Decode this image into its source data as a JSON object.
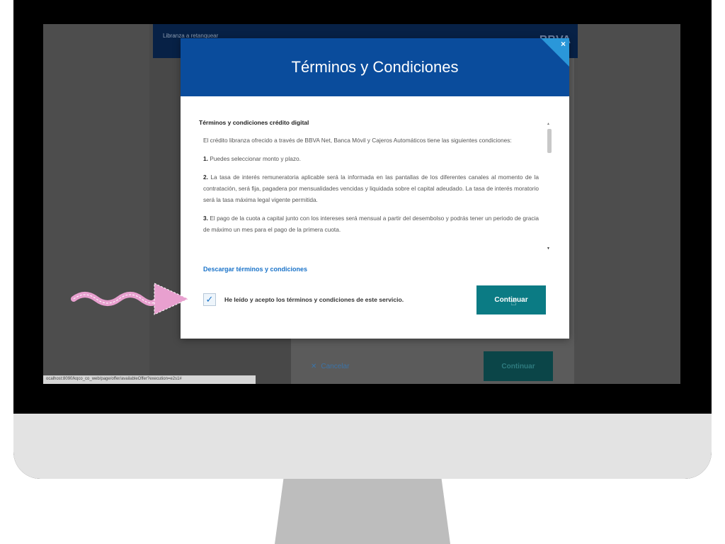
{
  "background_page": {
    "header_title": "Libranza a retanquear",
    "logo": "BBVA",
    "cancel_label": "Cancelar",
    "continue_label": "Continuar",
    "status_url": "ocalhost:8090/kqco_co_web/page/offer/availableOffer?execution=e2s1#"
  },
  "modal": {
    "title": "Términos y Condiciones",
    "close_icon": "×",
    "terms_heading": "Términos y condiciones crédito digital",
    "intro": "El crédito libranza ofrecido a través de BBVA Net, Banca Móvil y Cajeros Automáticos tiene las siguientes condiciones:",
    "items": [
      {
        "num": "1.",
        "text": "Puedes seleccionar monto y plazo."
      },
      {
        "num": "2.",
        "text": "La tasa de interés remuneratoria aplicable será la informada en las pantallas de los diferentes canales al momento de la contratación, será fija, pagadera por mensualidades vencidas y liquidada sobre el capital adeudado. La tasa de interés moratorio será la tasa máxima legal vigente permitida."
      },
      {
        "num": "3.",
        "text": "El pago de la cuota a capital junto con los intereses será mensual a partir del desembolso y podrás tener un periodo de gracia de máximo un mes para el pago de la primera cuota."
      }
    ],
    "download_link": "Descargar términos y condiciones",
    "checkbox_checked": true,
    "check_mark": "✓",
    "accept_label": "He leído y acepto los términos y condiciones de este servicio.",
    "continue_label": "Continuar"
  },
  "colors": {
    "header_blue": "#0a4c9c",
    "close_corner": "#2a97d9",
    "continue_teal": "#0b7b84",
    "link_blue": "#1a73c9",
    "annotation_pink": "#e8a0cf"
  },
  "icons": {
    "close": "close-icon",
    "cursor": "hand-cursor-icon",
    "check": "check-icon",
    "annotation": "wavy-arrow-icon"
  }
}
